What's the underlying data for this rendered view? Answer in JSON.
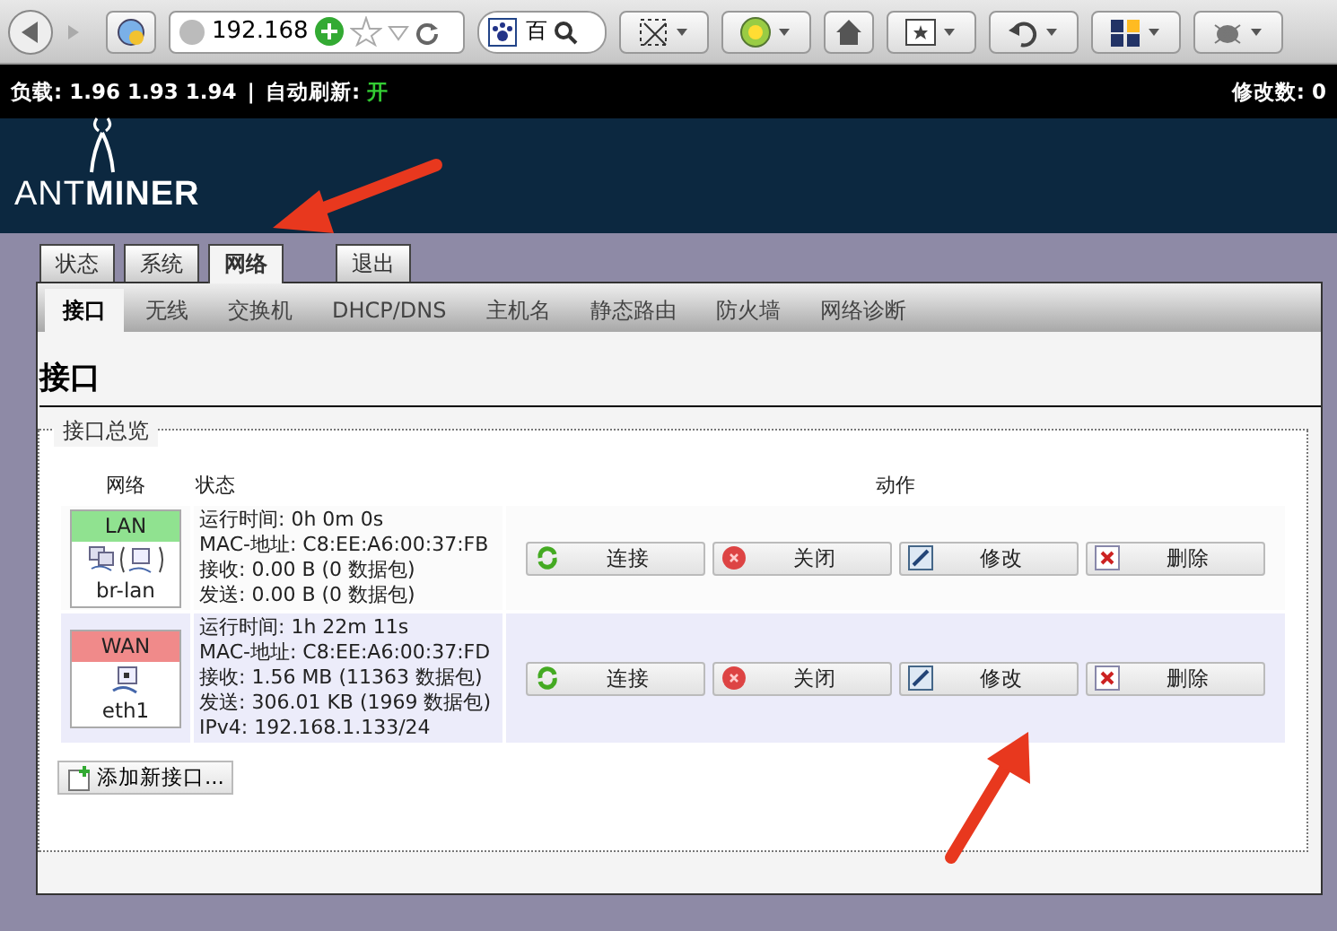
{
  "browser": {
    "url": "192.168",
    "search": "百"
  },
  "status_bar": {
    "load_label": "负载:",
    "load": "1.96 1.93 1.94",
    "separator": "|",
    "refresh_label": "自动刷新:",
    "refresh_value": "开",
    "changes": "修改数: 0"
  },
  "logo": "ANT**MINER**",
  "tabs": [
    {
      "label": "状态",
      "selected": false,
      "kind": "menu"
    },
    {
      "label": "系统",
      "selected": false,
      "kind": "menu"
    },
    {
      "label": "网络",
      "selected": true,
      "kind": "menu"
    },
    {
      "label": "退出",
      "selected": false,
      "kind": "logout"
    }
  ],
  "subtabs": [
    {
      "label": "接口",
      "selected": true
    },
    {
      "label": "无线",
      "selected": false
    },
    {
      "label": "交换机",
      "selected": false
    },
    {
      "label": "DHCP/DNS",
      "selected": false
    },
    {
      "label": "主机名",
      "selected": false
    },
    {
      "label": "静态路由",
      "selected": false
    },
    {
      "label": "防火墙",
      "selected": false
    },
    {
      "label": "网络诊断",
      "selected": false
    }
  ],
  "heading": "接口",
  "fieldset": {
    "legend": "接口总览",
    "columns": [
      "网络",
      "状态",
      "动作"
    ],
    "rows": [
      {
        "name": "LAN",
        "color": "#90e290",
        "kind": "bridge",
        "device": "br-lan",
        "shaded": false,
        "status": [
          "运行时间: 0h 0m 0s",
          "MAC-地址: C8:EE:A6:00:37:FB",
          "接收: 0.00 B (0 数据包)",
          "发送: 0.00 B (0 数据包)"
        ],
        "actions": [
          {
            "kind": "connect",
            "label": "连接"
          },
          {
            "kind": "stop",
            "label": "关闭"
          },
          {
            "kind": "edit",
            "label": "修改"
          },
          {
            "kind": "delete",
            "label": "删除"
          }
        ]
      },
      {
        "name": "WAN",
        "color": "#f08a8a",
        "kind": "ethernet",
        "device": "eth1",
        "shaded": true,
        "status": [
          "运行时间: 1h 22m 11s",
          "MAC-地址: C8:EE:A6:00:37:FD",
          "接收: 1.56 MB (11363 数据包)",
          "发送: 306.01 KB (1969 数据包)",
          "IPv4: 192.168.1.133/24"
        ],
        "actions": [
          {
            "kind": "connect",
            "label": "连接"
          },
          {
            "kind": "stop",
            "label": "关闭"
          },
          {
            "kind": "edit",
            "label": "修改"
          },
          {
            "kind": "delete",
            "label": "删除"
          }
        ]
      }
    ],
    "add_button": "添加新接口..."
  }
}
